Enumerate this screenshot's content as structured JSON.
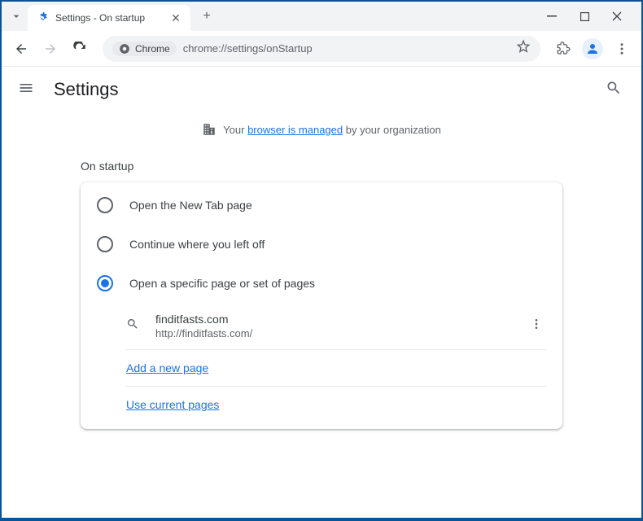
{
  "tab": {
    "title": "Settings - On startup"
  },
  "omnibox": {
    "chip": "Chrome",
    "url": "chrome://settings/onStartup"
  },
  "header": {
    "title": "Settings"
  },
  "managed": {
    "prefix": "Your ",
    "link": "browser is managed",
    "suffix": " by your organization"
  },
  "section": {
    "title": "On startup"
  },
  "options": {
    "opt1": "Open the New Tab page",
    "opt2": "Continue where you left off",
    "opt3": "Open a specific page or set of pages"
  },
  "page": {
    "title": "finditfasts.com",
    "url": "http://finditfasts.com/"
  },
  "links": {
    "add": "Add a new page",
    "current": "Use current pages"
  }
}
